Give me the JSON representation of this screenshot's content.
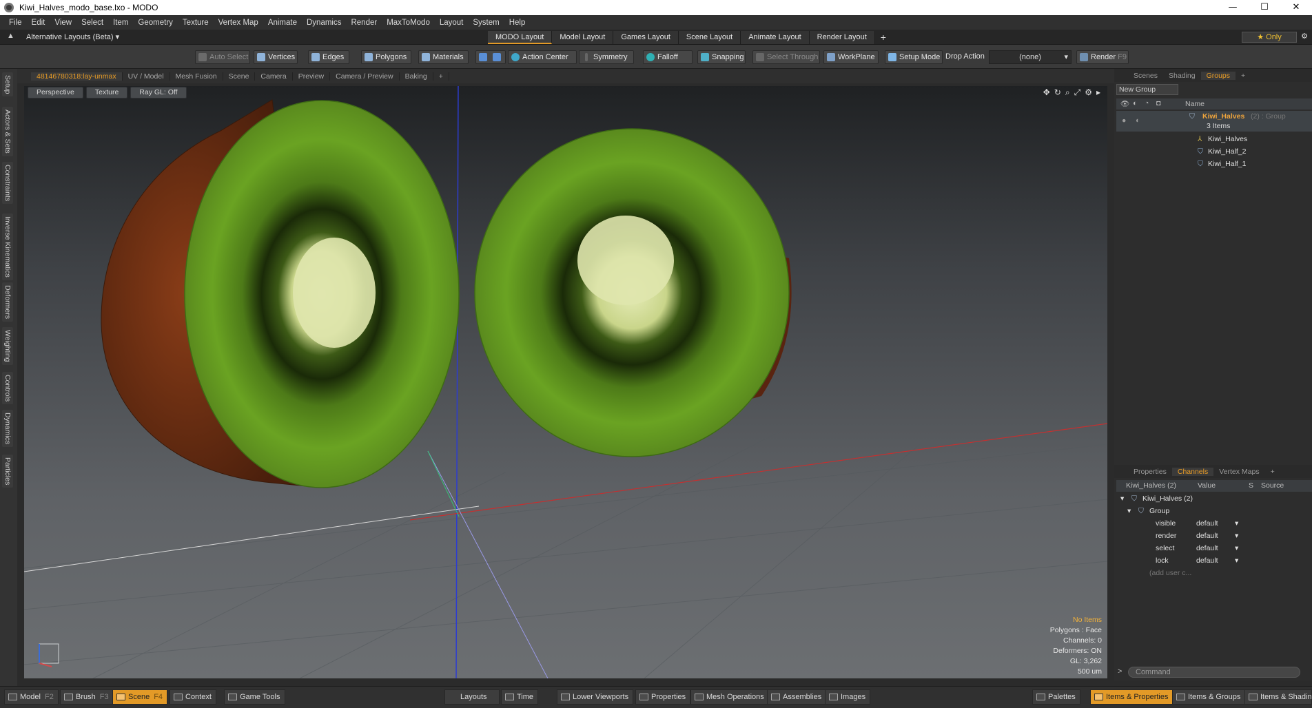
{
  "window": {
    "title": "Kiwi_Halves_modo_base.lxo - MODO",
    "minimize": "—",
    "maximize": "☐",
    "close": "✕"
  },
  "menu": [
    "File",
    "Edit",
    "View",
    "Select",
    "Item",
    "Geometry",
    "Texture",
    "Vertex Map",
    "Animate",
    "Dynamics",
    "Render",
    "MaxToModo",
    "Layout",
    "System",
    "Help"
  ],
  "layouts": {
    "label": "Alternative Layouts (Beta) ▾",
    "tabs": [
      "MODO Layout",
      "Model Layout",
      "Games Layout",
      "Scene Layout",
      "Animate Layout",
      "Render Layout"
    ],
    "add": "+",
    "only": "★ Only"
  },
  "toolbar": {
    "auto_select": "Auto Select",
    "vertices": "Vertices",
    "edges": "Edges",
    "polygons": "Polygons",
    "materials": "Materials",
    "action_center": "Action Center",
    "symmetry": "Symmetry",
    "falloff": "Falloff",
    "snapping": "Snapping",
    "select_through": "Select Through",
    "workplane": "WorkPlane",
    "setup_mode": "Setup Mode",
    "drop_action": "Drop Action",
    "drop_value": "(none)",
    "render": "Render",
    "render_key": "F9"
  },
  "side_tabs": [
    "Setup",
    "Actors & Sets",
    "Constraints",
    "Inverse Kinematics",
    "Deformers",
    "Weighting",
    "Controls",
    "Dynamics",
    "Particles"
  ],
  "viewport_tabs": [
    "48146780318:lay-unmax",
    "UV / Model",
    "Mesh Fusion",
    "Scene",
    "Camera",
    "Preview",
    "Camera / Preview",
    "Baking",
    "+"
  ],
  "viewport_buttons": [
    "Perspective",
    "Texture",
    "Ray GL: Off"
  ],
  "stats": {
    "items": "No Items",
    "polygons": "Polygons : Face",
    "channels": "Channels: 0",
    "deformers": "Deformers: ON",
    "gl": "GL: 3,262",
    "unit": "500 um"
  },
  "scene_tabs": [
    "Scenes",
    "Shading",
    "Groups",
    "+"
  ],
  "groups": {
    "new_group": "New Group",
    "name_header": "Name",
    "root": {
      "name": "Kiwi_Halves",
      "suffix": "(2) : Group",
      "count": "3 Items"
    },
    "children": [
      "Kiwi_Halves",
      "Kiwi_Half_2",
      "Kiwi_Half_1"
    ]
  },
  "prop_tabs": [
    "Properties",
    "Channels",
    "Vertex Maps",
    "+"
  ],
  "channels": {
    "header": {
      "name": "Kiwi_Halves (2)",
      "value": "Value",
      "s": "S",
      "source": "Source"
    },
    "root": "Kiwi_Halves (2)",
    "group": "Group",
    "rows": [
      {
        "name": "visible",
        "value": "default"
      },
      {
        "name": "render",
        "value": "default"
      },
      {
        "name": "select",
        "value": "default"
      },
      {
        "name": "lock",
        "value": "default"
      }
    ],
    "add": "(add user c..."
  },
  "command_placeholder": "Command",
  "bottom": {
    "model": "Model",
    "model_key": "F2",
    "brush": "Brush",
    "brush_key": "F3",
    "scene": "Scene",
    "scene_key": "F4",
    "context": "Context",
    "game_tools": "Game Tools",
    "layouts": "Layouts",
    "time": "Time",
    "lower_viewports": "Lower Viewports",
    "properties": "Properties",
    "mesh_operations": "Mesh Operations",
    "assemblies": "Assemblies",
    "images": "Images",
    "palettes": "Palettes",
    "items_properties": "Items & Properties",
    "items_groups": "Items & Groups",
    "items_shading": "Items & Shading"
  },
  "colors": {
    "accent": "#e39a27",
    "kiwi_green": "#5f9a1f",
    "kiwi_skin": "#6b2c12",
    "kiwi_core": "#d7dea0"
  }
}
